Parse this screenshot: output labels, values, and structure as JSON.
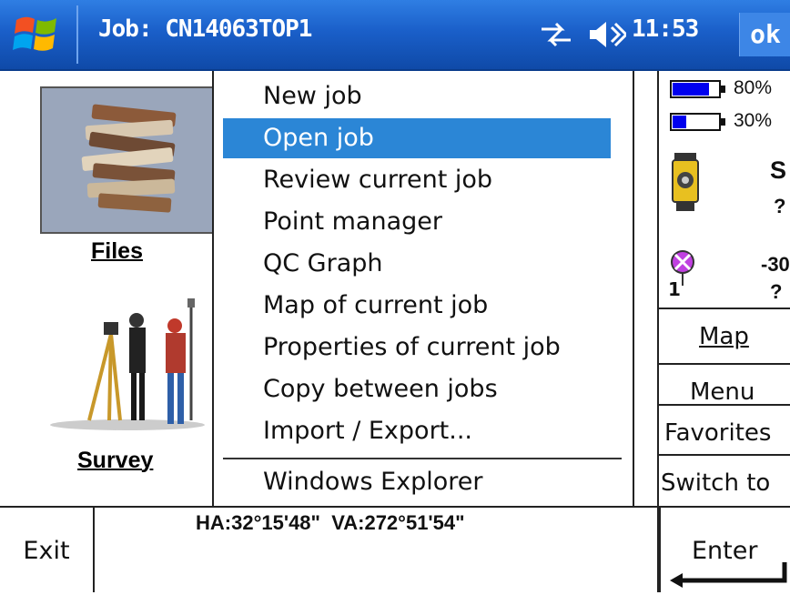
{
  "titlebar": {
    "title": "Job: CN14063TOP1",
    "clock": "11:53",
    "ok_label": "ok",
    "icons": [
      "windows-start-icon",
      "connectivity-icon",
      "speaker-icon"
    ]
  },
  "left_panel": {
    "files_label": "Files",
    "survey_label": "Survey"
  },
  "menu": {
    "items": [
      {
        "label": "New job",
        "selected": false
      },
      {
        "label": "Open job",
        "selected": true
      },
      {
        "label": "Review current job",
        "selected": false
      },
      {
        "label": "Point manager",
        "selected": false
      },
      {
        "label": "QC Graph",
        "selected": false
      },
      {
        "label": "Map of current job",
        "selected": false
      },
      {
        "label": "Properties of current job",
        "selected": false
      },
      {
        "label": "Copy between jobs",
        "selected": false
      },
      {
        "label": "Import / Export...",
        "selected": false
      },
      {
        "label": "Windows Explorer",
        "selected": false
      }
    ],
    "selected_color": "#2b86d6"
  },
  "status_panel": {
    "battery1": {
      "text": "80%",
      "level": 0.8
    },
    "battery2": {
      "text": "30%",
      "level": 0.3
    },
    "instrument_letter": "S",
    "instrument_value": "?",
    "gps_value": "-30",
    "gps_sub": "?",
    "sat_count": "1"
  },
  "side_buttons": [
    {
      "label": "Map"
    },
    {
      "label": "Menu"
    },
    {
      "label": "Favorites"
    },
    {
      "label": "Switch to"
    }
  ],
  "bottom": {
    "exit_label": "Exit",
    "angles": "HA:32°15'48\"  VA:272°51'54\"",
    "enter_label": "Enter"
  },
  "colors": {
    "titlebar": "#1a5fc9",
    "battery_fill": "#0000ee"
  }
}
